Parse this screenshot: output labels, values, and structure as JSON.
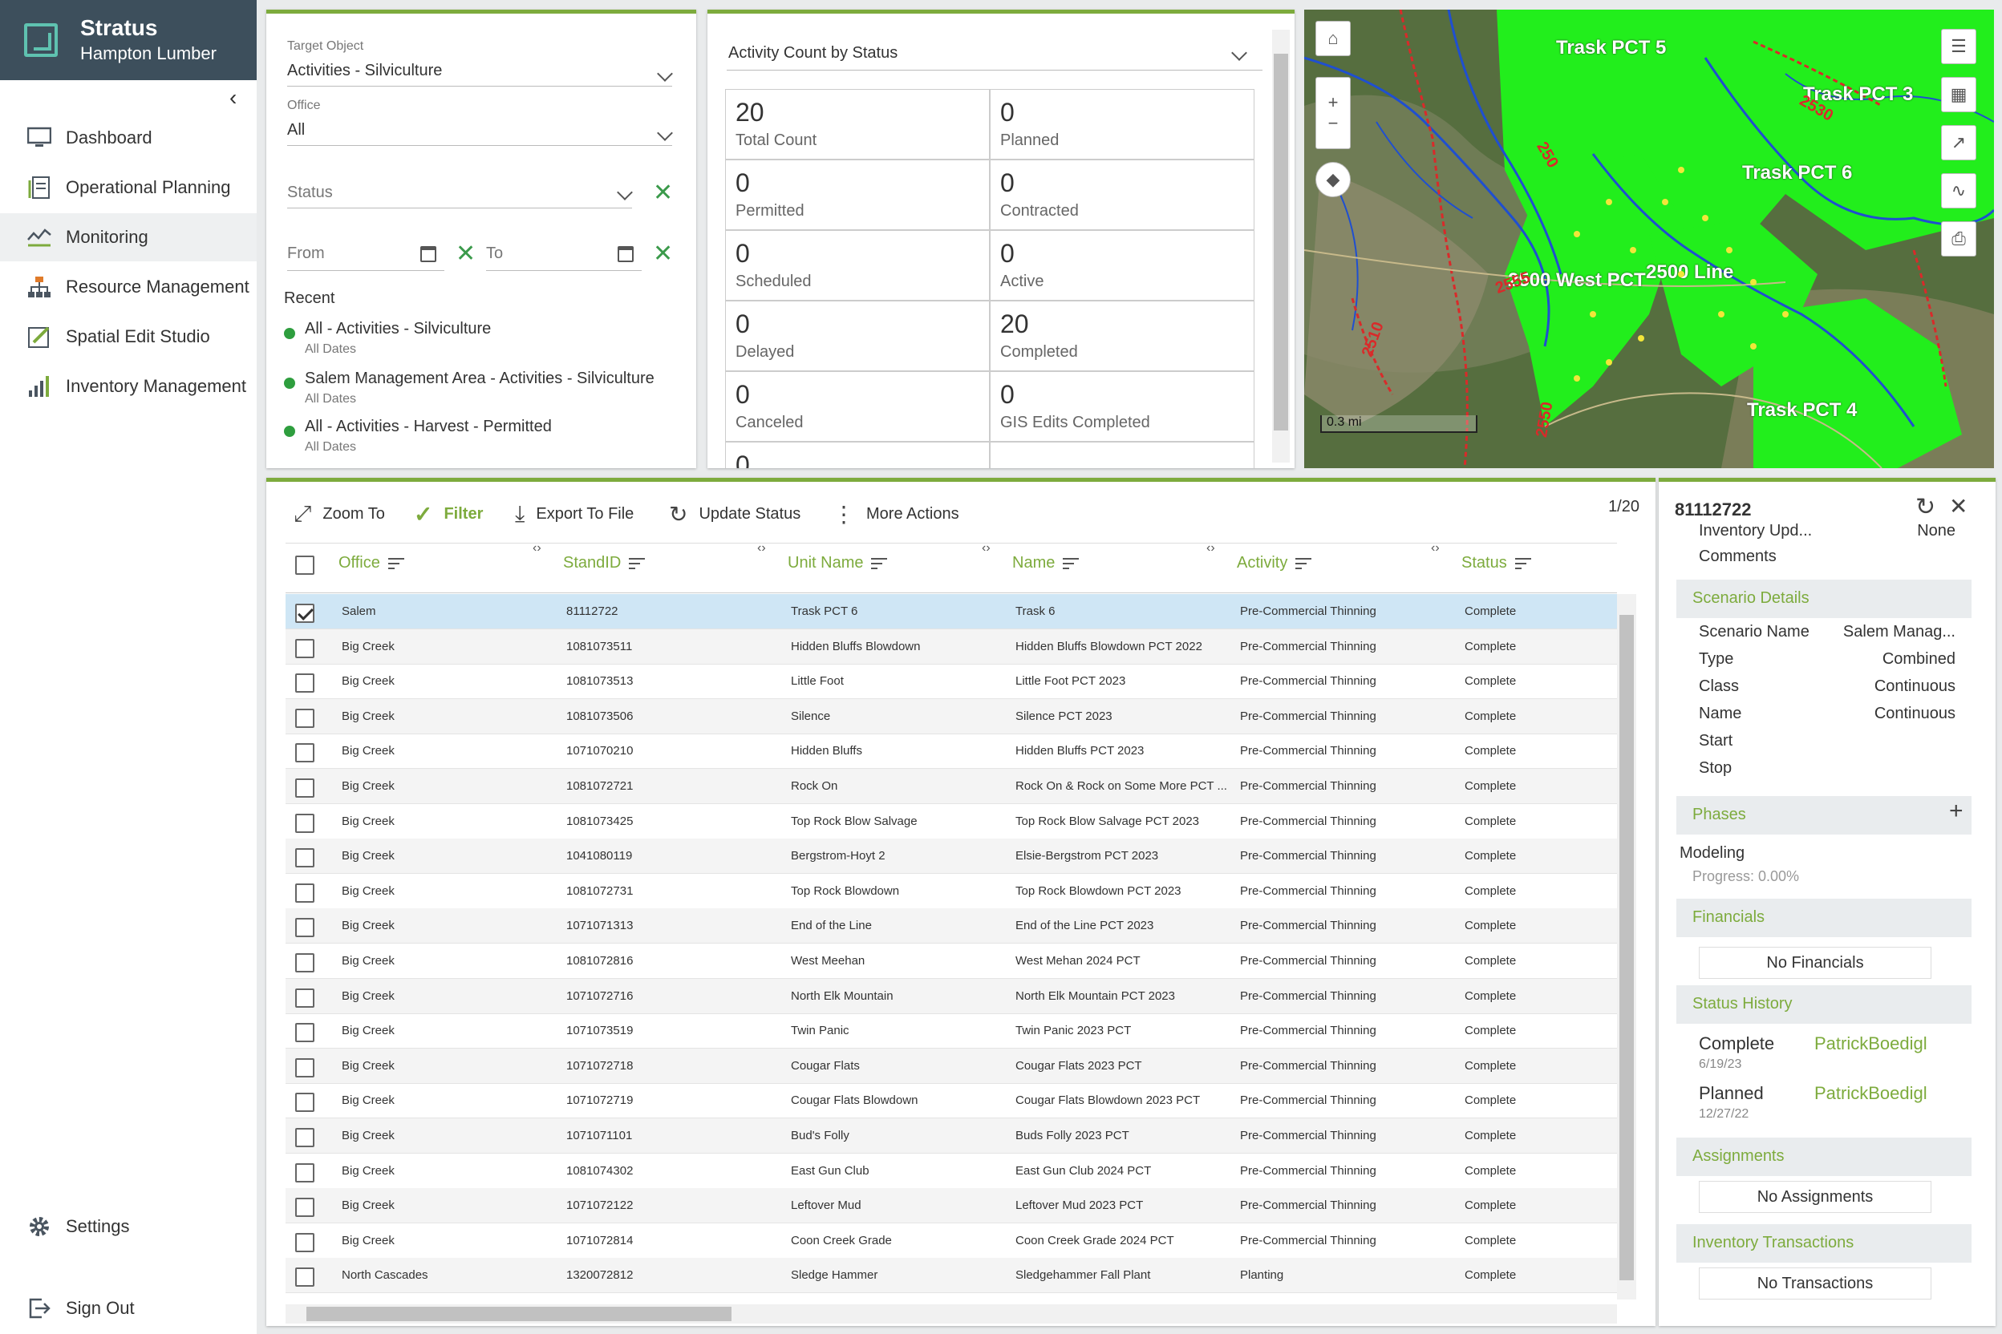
{
  "app": {
    "title": "Stratus",
    "subtitle": "Hampton Lumber"
  },
  "sidebar": {
    "items": [
      {
        "label": "Dashboard",
        "icon": "monitor-icon"
      },
      {
        "label": "Operational Planning",
        "icon": "planning-icon"
      },
      {
        "label": "Monitoring",
        "icon": "monitoring-icon",
        "active": true
      },
      {
        "label": "Resource Management",
        "icon": "hierarchy-icon"
      },
      {
        "label": "Spatial Edit Studio",
        "icon": "edit-icon"
      },
      {
        "label": "Inventory Management",
        "icon": "bar-chart-icon"
      }
    ],
    "settings": "Settings",
    "signout": "Sign Out"
  },
  "filters": {
    "target_label": "Target Object",
    "target_value": "Activities - Silviculture",
    "office_label": "Office",
    "office_value": "All",
    "status_placeholder": "Status",
    "from_placeholder": "From",
    "to_placeholder": "To",
    "recent_label": "Recent",
    "recent": [
      {
        "title": "All - Activities - Silviculture",
        "sub": "All Dates"
      },
      {
        "title": "Salem Management Area - Activities - Silviculture",
        "sub": "All Dates"
      },
      {
        "title": "All - Activities - Harvest - Permitted",
        "sub": "All Dates"
      }
    ]
  },
  "counts": {
    "title": "Activity Count by Status",
    "cells": [
      {
        "value": "20",
        "label": "Total Count"
      },
      {
        "value": "0",
        "label": "Planned"
      },
      {
        "value": "0",
        "label": "Permitted"
      },
      {
        "value": "0",
        "label": "Contracted"
      },
      {
        "value": "0",
        "label": "Scheduled"
      },
      {
        "value": "0",
        "label": "Active"
      },
      {
        "value": "0",
        "label": "Delayed"
      },
      {
        "value": "20",
        "label": "Completed"
      },
      {
        "value": "0",
        "label": "Canceled"
      },
      {
        "value": "0",
        "label": "GIS Edits Completed"
      },
      {
        "value": "0",
        "label": ""
      }
    ]
  },
  "map": {
    "labels": [
      "Trask PCT 5",
      "Trask PCT 3",
      "Trask PCT 6",
      "2500 West PCT",
      "2500 Line",
      "Trask PCT 4"
    ],
    "road_labels": [
      "2530",
      "2510",
      "2550",
      "2555",
      "250"
    ],
    "scale": "0.3 mi",
    "colors": {
      "stand": "#22ee1c",
      "forest": "#4f6b3a",
      "stream": "#1f4fd0",
      "roads": "#d92a2a"
    }
  },
  "toolbar": {
    "zoom_to": "Zoom To",
    "filter": "Filter",
    "export": "Export To File",
    "update_status": "Update Status",
    "more": "More Actions",
    "page_count": "1/20"
  },
  "table": {
    "columns": [
      "Office",
      "StandID",
      "Unit Name",
      "Name",
      "Activity",
      "Status"
    ],
    "rows": [
      [
        "Salem",
        "81112722",
        "Trask PCT 6",
        "Trask 6",
        "Pre-Commercial Thinning",
        "Complete"
      ],
      [
        "Big Creek",
        "1081073511",
        "Hidden Bluffs Blowdown",
        "Hidden Bluffs Blowdown PCT 2022",
        "Pre-Commercial Thinning",
        "Complete"
      ],
      [
        "Big Creek",
        "1081073513",
        "Little Foot",
        "Little Foot PCT 2023",
        "Pre-Commercial Thinning",
        "Complete"
      ],
      [
        "Big Creek",
        "1081073506",
        "Silence",
        "Silence PCT 2023",
        "Pre-Commercial Thinning",
        "Complete"
      ],
      [
        "Big Creek",
        "1071070210",
        "Hidden Bluffs",
        "Hidden Bluffs PCT 2023",
        "Pre-Commercial Thinning",
        "Complete"
      ],
      [
        "Big Creek",
        "1081072721",
        "Rock On",
        "Rock On & Rock on Some More PCT ...",
        "Pre-Commercial Thinning",
        "Complete"
      ],
      [
        "Big Creek",
        "1081073425",
        "Top Rock Blow Salvage",
        "Top Rock Blow Salvage PCT 2023",
        "Pre-Commercial Thinning",
        "Complete"
      ],
      [
        "Big Creek",
        "1041080119",
        "Bergstrom-Hoyt 2",
        "Elsie-Bergstrom PCT 2023",
        "Pre-Commercial Thinning",
        "Complete"
      ],
      [
        "Big Creek",
        "1081072731",
        "Top Rock Blowdown",
        "Top Rock Blowdown PCT 2023",
        "Pre-Commercial Thinning",
        "Complete"
      ],
      [
        "Big Creek",
        "1071071313",
        "End of the Line",
        "End of the Line PCT 2023",
        "Pre-Commercial Thinning",
        "Complete"
      ],
      [
        "Big Creek",
        "1081072816",
        "West Meehan",
        "West Mehan 2024 PCT",
        "Pre-Commercial Thinning",
        "Complete"
      ],
      [
        "Big Creek",
        "1071072716",
        "North Elk Mountain",
        "North Elk Mountain PCT 2023",
        "Pre-Commercial Thinning",
        "Complete"
      ],
      [
        "Big Creek",
        "1071073519",
        "Twin Panic",
        "Twin Panic 2023 PCT",
        "Pre-Commercial Thinning",
        "Complete"
      ],
      [
        "Big Creek",
        "1071072718",
        "Cougar Flats",
        "Cougar Flats 2023 PCT",
        "Pre-Commercial Thinning",
        "Complete"
      ],
      [
        "Big Creek",
        "1071072719",
        "Cougar Flats Blowdown",
        "Cougar Flats Blowdown 2023 PCT",
        "Pre-Commercial Thinning",
        "Complete"
      ],
      [
        "Big Creek",
        "1071071101",
        "Bud's Folly",
        "Buds Folly 2023 PCT",
        "Pre-Commercial Thinning",
        "Complete"
      ],
      [
        "Big Creek",
        "1081074302",
        "East Gun Club",
        "East Gun Club 2024 PCT",
        "Pre-Commercial Thinning",
        "Complete"
      ],
      [
        "Big Creek",
        "1071072122",
        "Leftover Mud",
        "Leftover Mud 2023 PCT",
        "Pre-Commercial Thinning",
        "Complete"
      ],
      [
        "Big Creek",
        "1071072814",
        "Coon Creek Grade",
        "Coon Creek Grade 2024 PCT",
        "Pre-Commercial Thinning",
        "Complete"
      ],
      [
        "North Cascades",
        "1320072812",
        "Sledge Hammer",
        "Sledgehammer Fall Plant",
        "Planting",
        "Complete"
      ]
    ]
  },
  "detail": {
    "title": "81112722",
    "inventory_key": "Inventory Upd...",
    "inventory_val": "None",
    "comments": "Comments",
    "scenario_section": "Scenario Details",
    "scenario": [
      {
        "key": "Scenario Name",
        "val": "Salem Manag..."
      },
      {
        "key": "Type",
        "val": "Combined"
      },
      {
        "key": "Class",
        "val": "Continuous"
      },
      {
        "key": "Name",
        "val": "Continuous"
      },
      {
        "key": "Start",
        "val": ""
      },
      {
        "key": "Stop",
        "val": ""
      }
    ],
    "phases_section": "Phases",
    "phase_name": "Modeling",
    "phase_progress": "Progress: 0.00%",
    "financials_section": "Financials",
    "financials_empty": "No Financials",
    "history_section": "Status History",
    "history": [
      {
        "status": "Complete",
        "date": "6/19/23",
        "user": "PatrickBoedigl"
      },
      {
        "status": "Planned",
        "date": "12/27/22",
        "user": "PatrickBoedigl"
      }
    ],
    "assignments_section": "Assignments",
    "assignments_empty": "No Assignments",
    "transactions_section": "Inventory Transactions",
    "transactions_empty": "No Transactions"
  }
}
